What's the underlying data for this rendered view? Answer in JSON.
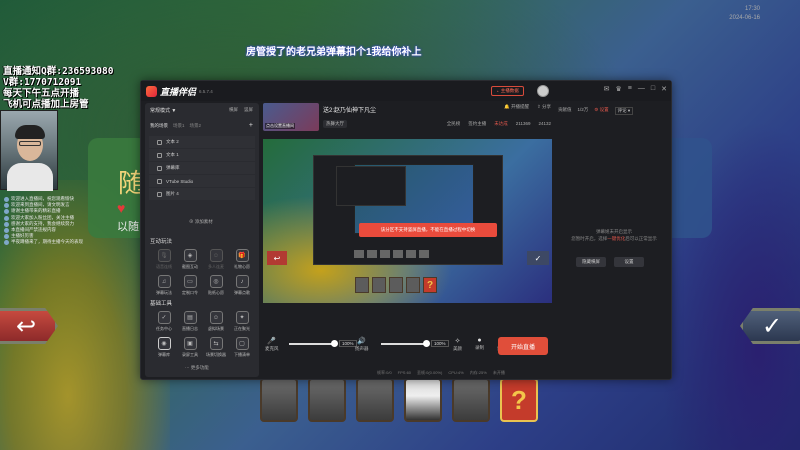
{
  "background": {
    "marquee": "房管授了的老兄弟弹幕扣个1我给你补上",
    "notice_lines": [
      "直播通知Q群:236593080",
      "V群:1770712091",
      "每天下午五点开播",
      "飞机可点播加上房管"
    ],
    "card_big_char": "随",
    "card_small_text": "以随",
    "clock_lines": [
      "17:30",
      "2024-06-16"
    ],
    "chat_lines": [
      "欢迎进入直播间，祝您观看愉快",
      "欢迎来到直播间，请文明发言",
      "谢谢主播带来的精彩直播",
      "欢迎大家加入粉丝团，关注主播",
      "感谢大家的支持，我会继续努力",
      "本直播间严禁违规内容",
      "主播好厉害",
      "半夜蹲播来了，期待主播今天的表现"
    ]
  },
  "app": {
    "name": "直播伴侣",
    "version": "6.5.7.4",
    "theme_button": "主播数据",
    "titlebar_icons": [
      "message-icon",
      "shirt-icon",
      "menu-icon",
      "minimize-icon",
      "maximize-icon",
      "close-icon"
    ],
    "left": {
      "mode": "常规模式",
      "links": [
        "横屏",
        "竖屏"
      ],
      "scene_tabs": [
        "我的场景",
        "场景1",
        "场景2"
      ],
      "scenes": [
        "文本 2",
        "文本 1",
        "弹幕库",
        "VTube Studio",
        "图片 4"
      ],
      "add_material": "添加素材",
      "section_interactive": "互动玩法",
      "interactive_items": [
        {
          "label": "语音连线",
          "icon": "🎙",
          "dim": true
        },
        {
          "label": "截图互动",
          "icon": "◈",
          "dim": false
        },
        {
          "label": "多人连麦",
          "icon": "☺",
          "dim": true
        },
        {
          "label": "礼物心愿",
          "icon": "🎁",
          "dim": false
        },
        {
          "label": "弹幕玩法",
          "icon": "♫",
          "dim": false
        },
        {
          "label": "定制口令",
          "icon": "▭",
          "dim": false
        },
        {
          "label": "贴纸心愿",
          "icon": "◎",
          "dim": false
        },
        {
          "label": "弹幕点歌",
          "icon": "♪",
          "dim": false
        }
      ],
      "section_tools": "基础工具",
      "tool_items": [
        {
          "label": "任务中心",
          "icon": "✓",
          "sel": false
        },
        {
          "label": "直播日志",
          "icon": "▤",
          "sel": false
        },
        {
          "label": "虚拟场景",
          "icon": "☺",
          "sel": false
        },
        {
          "label": "正在聚光",
          "icon": "✦",
          "sel": false
        },
        {
          "label": "弹幕库",
          "icon": "◉",
          "sel": true
        },
        {
          "label": "录屏工具",
          "icon": "▣",
          "sel": false
        },
        {
          "label": "场景切换器",
          "icon": "⇆",
          "sel": false
        },
        {
          "label": "下播清单",
          "icon": "▢",
          "sel": false
        }
      ],
      "more_functions": "更多功能"
    },
    "room": {
      "thumb_caption": "点击设置直播间",
      "title": "送2:赵乃仙神下凡尘",
      "category": "热舞大厅",
      "actions": [
        "开播提醒",
        "分享"
      ],
      "stats": [
        "全民榜",
        "签约主播",
        "未达成",
        "211369",
        "24132"
      ]
    },
    "preview": {
      "toast": "该分区不支持竖屏直播，不能在直播过程中切换",
      "left_button_icon": "↩",
      "right_button_icon": "✓",
      "question_mark": "?"
    },
    "controls": {
      "mic_label": "麦克风",
      "mic_volume": "100%",
      "speaker_label": "扬声器",
      "speaker_volume": "100%",
      "beauty_label": "美颜",
      "record_label": "录制",
      "settings_label": "设置",
      "start_button": "开始直播"
    },
    "status": [
      "帧率:0/0",
      "FPS:60",
      "丢帧:0(0.00%)",
      "CPU:4%",
      "内存:25%",
      "未开播"
    ],
    "right": {
      "tabs": [
        "贡献值",
        "1/2万",
        "设置",
        "评论"
      ],
      "empty_message_pre": "弹幕姬未开启显示",
      "empty_message_mid": "您暂时开启，选择",
      "empty_message_link": "一键优化",
      "empty_message_post": "后可以正常显示",
      "buttons": [
        "隐藏横屏",
        "设置"
      ]
    },
    "colors": {
      "accent": "#e04e3a",
      "panel_bg": "#2a2b30",
      "window_bg": "#1d1e22"
    }
  }
}
